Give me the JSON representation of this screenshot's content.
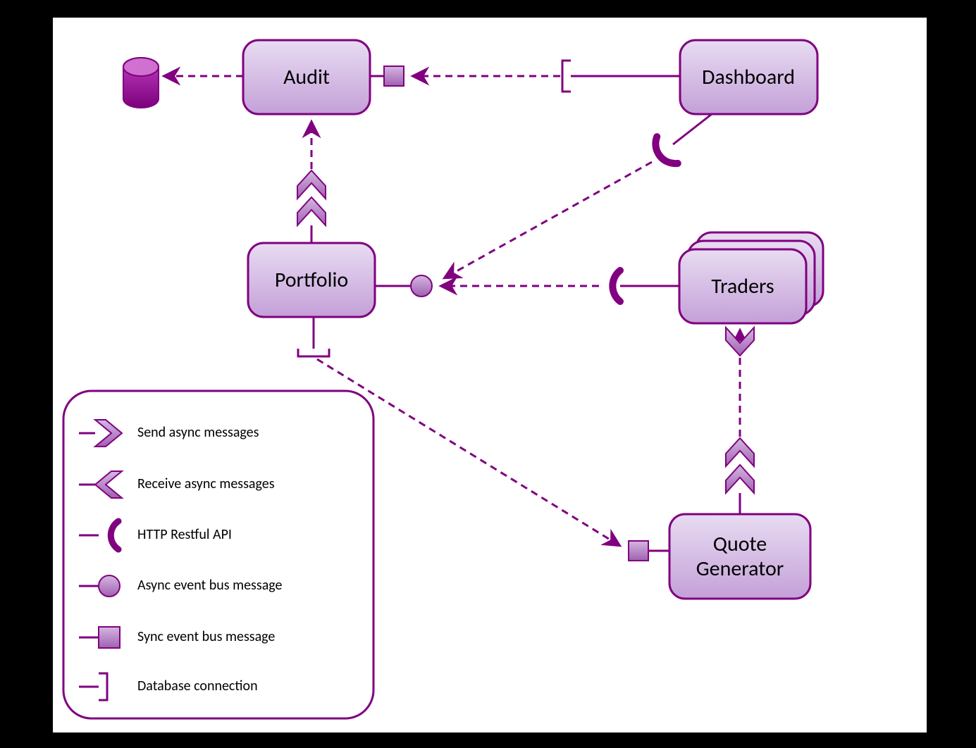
{
  "nodes": {
    "audit": "Audit",
    "dashboard": "Dashboard",
    "portfolio": "Portfolio",
    "traders": "Traders",
    "quoteGenerator": "Quote\nGenerator"
  },
  "legend": {
    "sendAsync": "Send async messages",
    "receiveAsync": "Receive async messages",
    "http": "HTTP Restful API",
    "async": "Async event bus message",
    "sync": "Sync event bus message",
    "database": "Database connection"
  },
  "colors": {
    "stroke": "#80007F",
    "fillNode1": "#E6D9F0",
    "fillNode2": "#C8A8D8",
    "fillShape1": "#C8A8D8",
    "fillShape2": "#A060B0",
    "dbTop": "#BF40BF",
    "dbBottom": "#7D007D"
  }
}
